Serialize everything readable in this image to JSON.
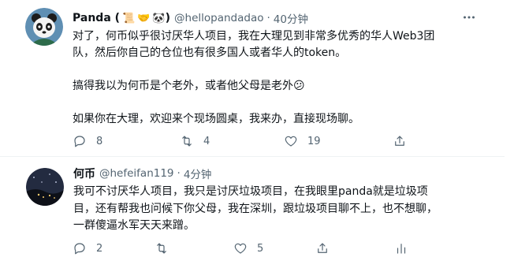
{
  "tweets": [
    {
      "author": {
        "name": "Panda (",
        "emojis": [
          "📜",
          "🤝",
          "🐼",
          ")"
        ],
        "handle": "@hellopandadao",
        "time": "40分钟"
      },
      "dot": "·",
      "body": "对了，何币似乎很讨厌华人项目，我在大理见到非常多优秀的华人Web3团\n队，然后你自己的仓位也有很多国人或者华人的token。\n\n搞得我以为何币是个老外，或者他父母是老外😕\n\n如果你在大理，欢迎来个现场圆桌，我来办，直接现场聊。",
      "actions": {
        "reply": "8",
        "retweet": "4",
        "like": "19"
      }
    },
    {
      "author": {
        "name": "何币",
        "handle": "@hefeifan119",
        "time": "4分钟"
      },
      "dot": "·",
      "body": "我可不讨厌华人项目，我只是讨厌垃圾项目，在我眼里panda就是垃圾项\n目，还有帮我也问候下你父母，我在深圳，跟垃圾项目聊不上，也不想聊，\n一群傻逼水军天天来蹭。",
      "actions": {
        "reply": "2",
        "retweet": "",
        "like": "5"
      }
    }
  ],
  "colors": {
    "text": "#0f1419",
    "secondary": "#536471",
    "divider": "#eff3f4"
  },
  "icons": [
    "reply-icon",
    "retweet-icon",
    "like-icon",
    "share-icon",
    "analytics-icon",
    "more-icon"
  ]
}
